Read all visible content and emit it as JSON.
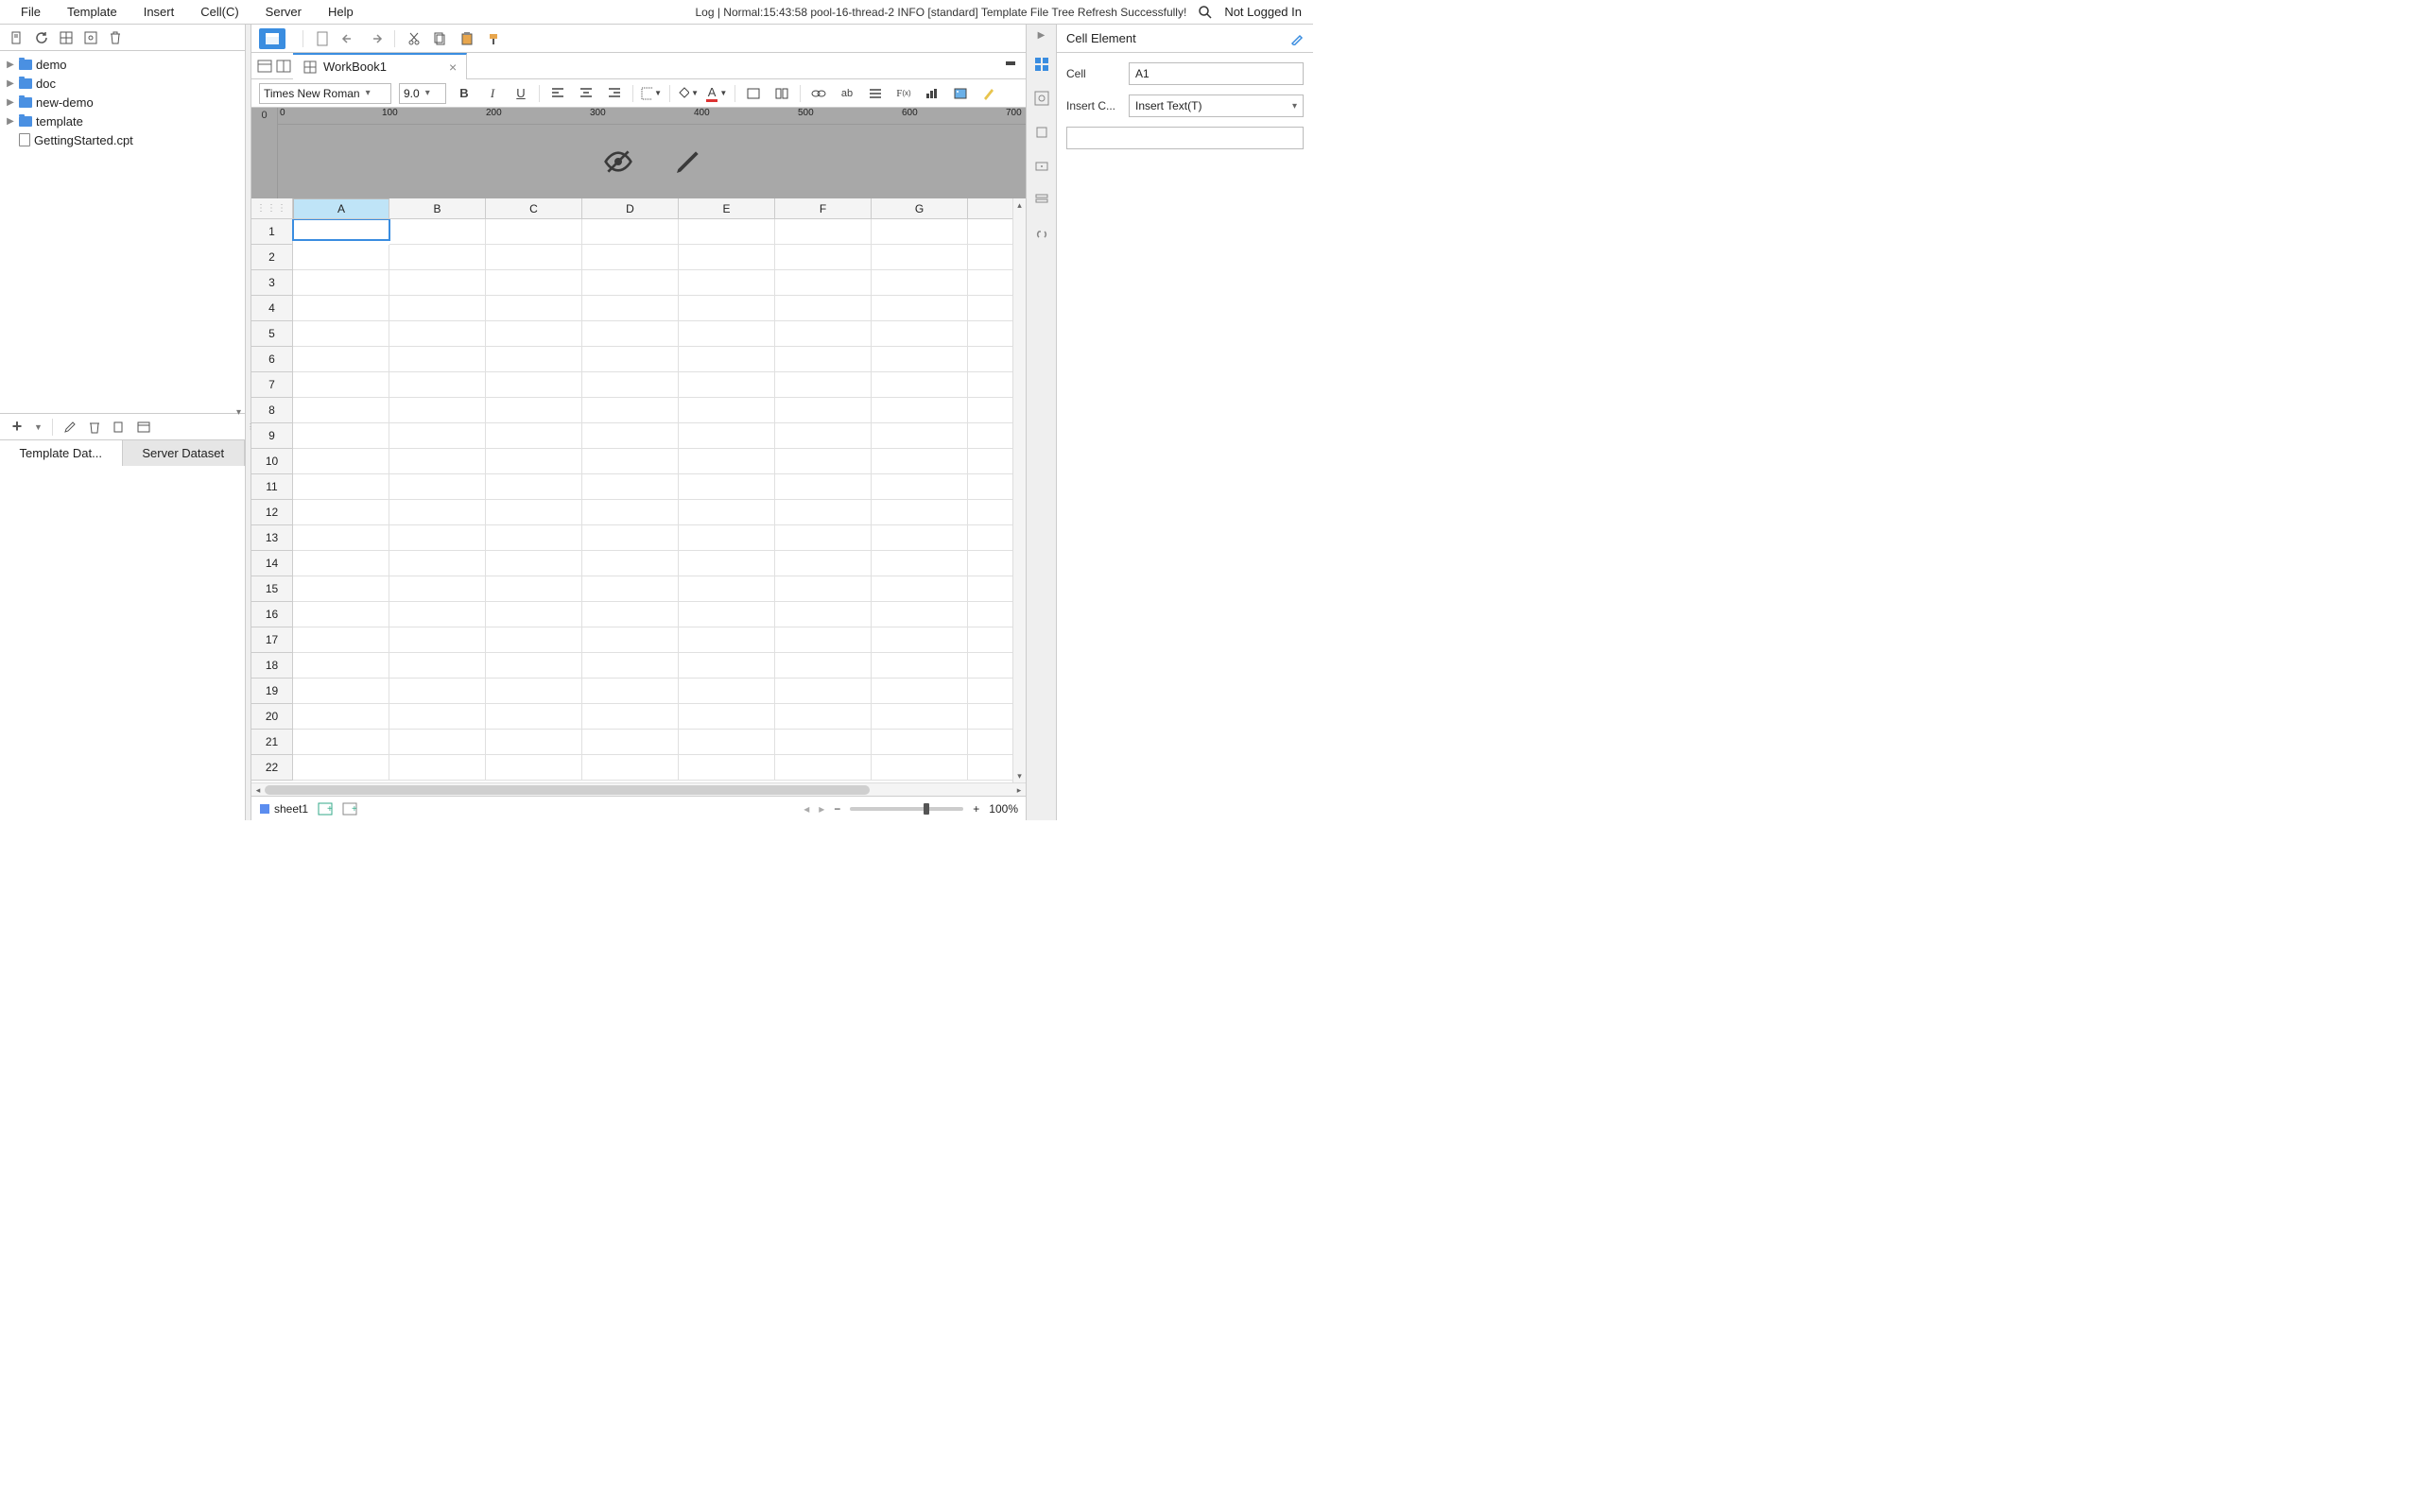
{
  "menu": {
    "items": [
      "File",
      "Template",
      "Insert",
      "Cell(C)",
      "Server",
      "Help"
    ]
  },
  "log": "Log | Normal:15:43:58 pool-16-thread-2 INFO [standard] Template File Tree Refresh Successfully!",
  "login": "Not Logged In",
  "tree": [
    {
      "type": "folder",
      "label": "demo"
    },
    {
      "type": "folder",
      "label": "doc"
    },
    {
      "type": "folder",
      "label": "new-demo"
    },
    {
      "type": "folder",
      "label": "template"
    },
    {
      "type": "file",
      "label": "GettingStarted.cpt"
    }
  ],
  "dataset_tabs": [
    "Template Dat...",
    "Server Dataset"
  ],
  "doc_tab": "WorkBook1",
  "font": {
    "name": "Times New Roman",
    "size": "9.0"
  },
  "ruler": {
    "ticks": [
      "0",
      "100",
      "200",
      "300",
      "400",
      "500",
      "600",
      "700"
    ],
    "origin": "0"
  },
  "cols": [
    "A",
    "B",
    "C",
    "D",
    "E",
    "F",
    "G"
  ],
  "rows": 22,
  "selected_cell": "A1",
  "sheet": "sheet1",
  "zoom": "100%",
  "panel": {
    "title": "Cell Element",
    "cell_label": "Cell",
    "cell_value": "A1",
    "insert_label": "Insert C...",
    "insert_value": "Insert Text(T)"
  }
}
